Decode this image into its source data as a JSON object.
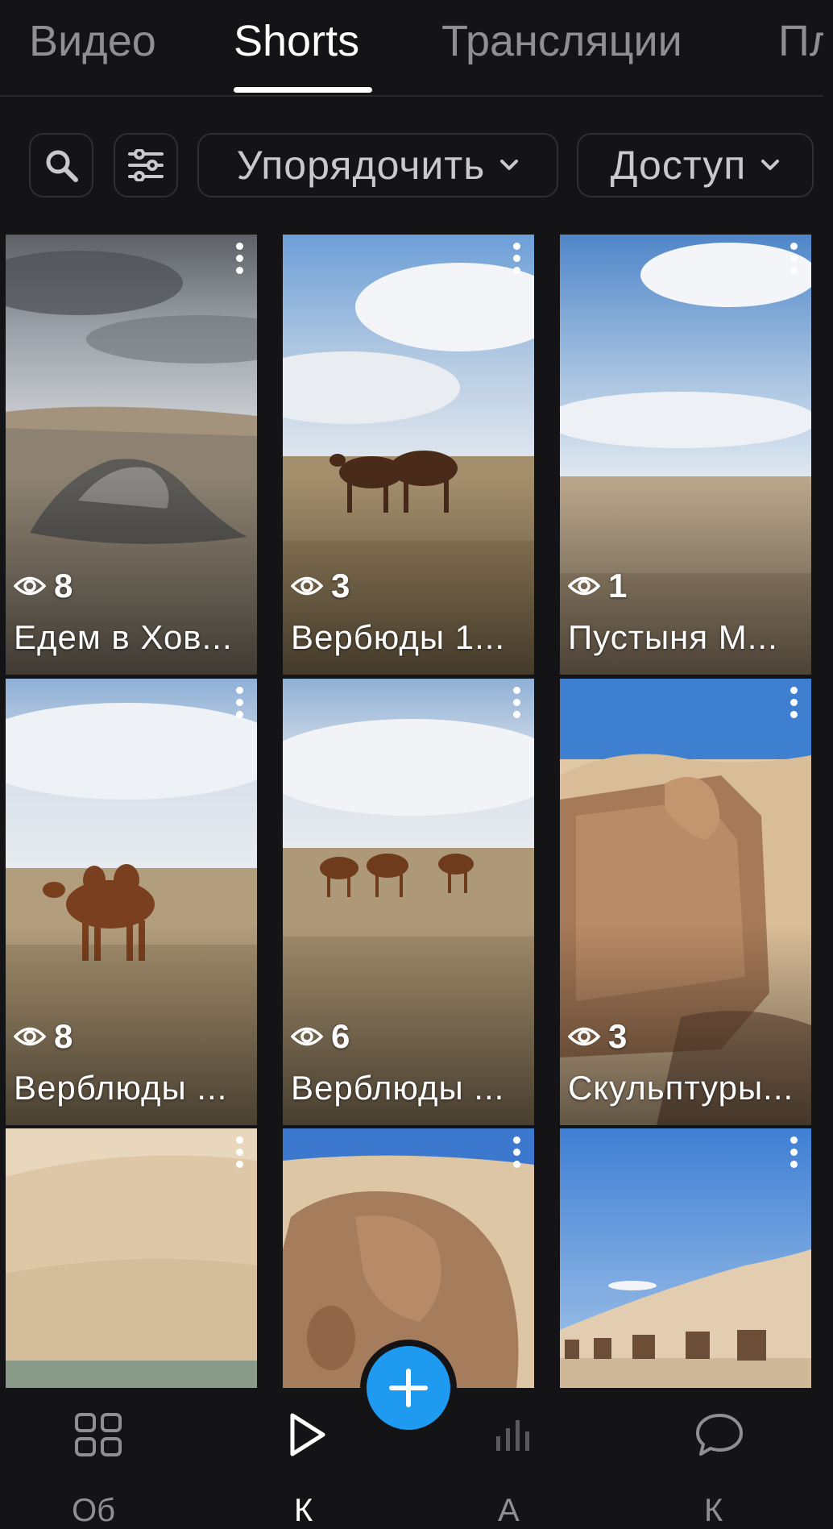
{
  "tabs": [
    {
      "label": "Видео",
      "active": false
    },
    {
      "label": "Shorts",
      "active": true
    },
    {
      "label": "Трансляции",
      "active": false
    },
    {
      "label": "Пл",
      "active": false
    }
  ],
  "toolbar": {
    "search_icon": "search-icon",
    "filter_icon": "filter-icon",
    "sort_label": "Упорядочить",
    "access_label": "Доступ"
  },
  "shorts": [
    {
      "title": "Едем в Хов...",
      "views": "8",
      "scene": "cairn"
    },
    {
      "title": "Вербюды 1...",
      "views": "3",
      "scene": "camels-three"
    },
    {
      "title": "Пустыня М...",
      "views": "1",
      "scene": "desert-plain"
    },
    {
      "title": "Верблюды ...",
      "views": "8",
      "scene": "camel-one"
    },
    {
      "title": "Верблюды ...",
      "views": "6",
      "scene": "camels-herd"
    },
    {
      "title": "Скульптуры...",
      "views": "3",
      "scene": "sculpture-wall"
    },
    {
      "title": "",
      "views": "",
      "scene": "dunes"
    },
    {
      "title": "",
      "views": "",
      "scene": "sculpture-camel"
    },
    {
      "title": "",
      "views": "",
      "scene": "sculpture-row"
    }
  ],
  "bottom_nav": {
    "items": [
      {
        "icon": "dashboard-icon",
        "label": "Об"
      },
      {
        "icon": "play-icon",
        "label": "К"
      },
      {
        "icon": "analytics-icon",
        "label": "А"
      },
      {
        "icon": "comments-icon",
        "label": "К"
      }
    ],
    "fab_icon": "plus-icon"
  },
  "colors": {
    "background": "#141416",
    "accent": "#1e9bf0",
    "inactive_text": "#8e8e93"
  }
}
